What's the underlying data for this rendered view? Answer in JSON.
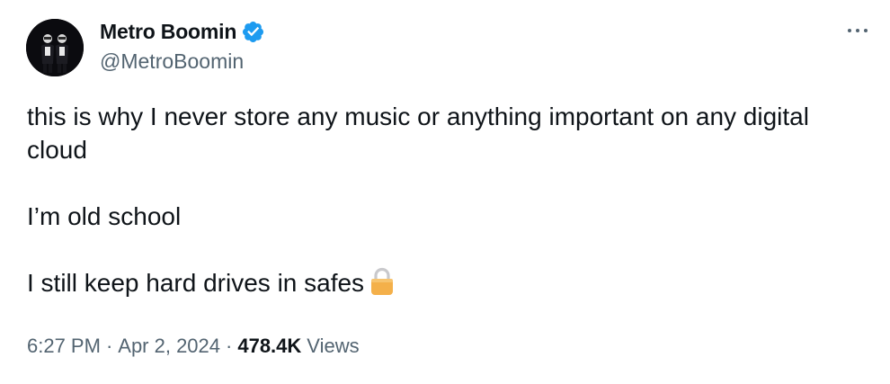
{
  "author": {
    "display_name": "Metro Boomin",
    "handle": "@MetroBoomin",
    "verified": true,
    "avatar_icon": "profile-photo"
  },
  "tweet": {
    "paragraphs": [
      "this is why I never store any music or anything important on any digital cloud",
      "I’m old school",
      "I still keep hard drives in safes"
    ],
    "trailing_emoji": "lock-emoji"
  },
  "meta": {
    "time": "6:27 PM",
    "separator": "·",
    "date": "Apr 2, 2024",
    "views_count": "478.4K",
    "views_label": "Views"
  },
  "colors": {
    "text_primary": "#0f1419",
    "text_secondary": "#536471",
    "verified_blue": "#1d9bf0",
    "lock_gold": "#f4b04a"
  }
}
